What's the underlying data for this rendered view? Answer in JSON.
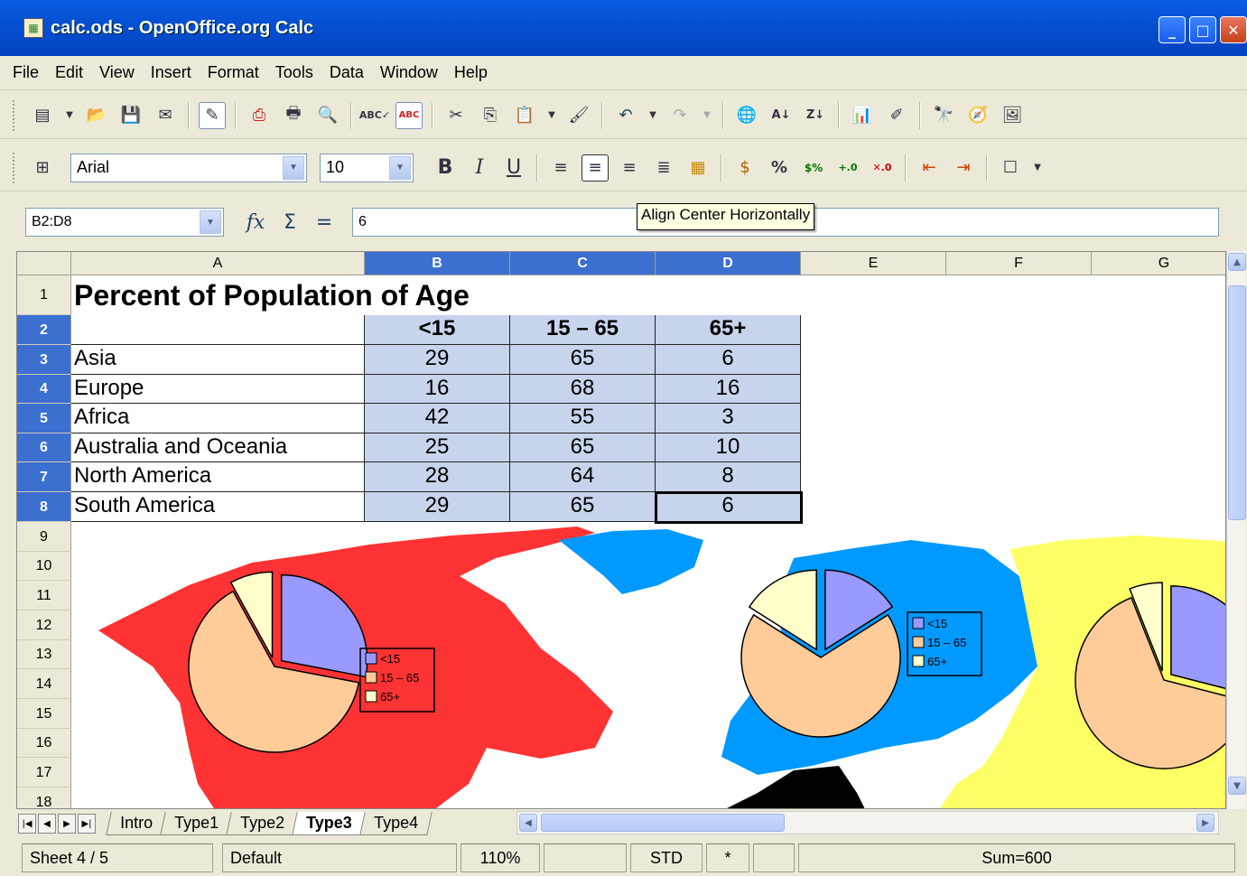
{
  "window": {
    "title": "calc.ods - OpenOffice.org Calc"
  },
  "menu": [
    "File",
    "Edit",
    "View",
    "Insert",
    "Format",
    "Tools",
    "Data",
    "Window",
    "Help"
  ],
  "formatting": {
    "font_name": "Arial",
    "font_size": "10"
  },
  "formula_bar": {
    "name_box": "B2:D8",
    "value": "6"
  },
  "tooltip": "Align Center Horizontally",
  "columns": [
    "A",
    "B",
    "C",
    "D",
    "E",
    "F",
    "G"
  ],
  "rows": [
    "1",
    "2",
    "3",
    "4",
    "5",
    "6",
    "7",
    "8",
    "9",
    "10",
    "11",
    "12",
    "13",
    "14",
    "15",
    "16",
    "17",
    "18"
  ],
  "sheet": {
    "title": "Percent of Population of Age",
    "headers": [
      "<15",
      "15 – 65",
      "65+"
    ],
    "data": [
      {
        "region": "Asia",
        "values": [
          "29",
          "65",
          "6"
        ]
      },
      {
        "region": "Europe",
        "values": [
          "16",
          "68",
          "16"
        ]
      },
      {
        "region": "Africa",
        "values": [
          "42",
          "55",
          "3"
        ]
      },
      {
        "region": "Australia and Oceania",
        "values": [
          "25",
          "65",
          "10"
        ]
      },
      {
        "region": "North America",
        "values": [
          "28",
          "64",
          "8"
        ]
      },
      {
        "region": "South America",
        "values": [
          "29",
          "65",
          "6"
        ]
      }
    ]
  },
  "chart_legend": [
    "<15",
    "15 – 65",
    "65+"
  ],
  "chart_colors": {
    "lt15": "#9999ff",
    "mid": "#ffcc99",
    "ge65": "#ffffcc",
    "americas": "#ff3333",
    "europe": "#0099ff",
    "asia": "#ffff66"
  },
  "sheet_tabs": [
    "Intro",
    "Type1",
    "Type2",
    "Type3",
    "Type4"
  ],
  "active_tab": "Type3",
  "status": {
    "sheet": "Sheet 4 / 5",
    "style": "Default",
    "zoom": "110%",
    "mode": "STD",
    "modified": "*",
    "sum": "Sum=600"
  }
}
